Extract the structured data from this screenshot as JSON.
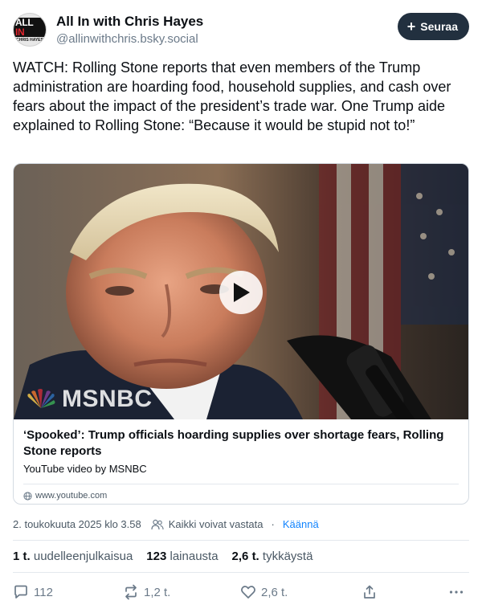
{
  "header": {
    "display_name": "All In with Chris Hayes",
    "handle": "@allinwithchris.bsky.social",
    "avatar_line1_a": "ALL ",
    "avatar_line1_b": "IN",
    "avatar_line2": "CHRIS HAYES",
    "follow_label": "Seuraa"
  },
  "post": {
    "text": "WATCH: Rolling Stone reports that even members of the Trump administration are hoarding food, household supplies, and cash over fears about the impact of the president’s trade war. One Trump aide explained to Rolling Stone: “Because it would be stupid not to!”"
  },
  "embed": {
    "overlay_logo_text": "MSNBC",
    "title": "‘Spooked’: Trump officials hoarding supplies over shortage fears, Rolling Stone reports",
    "description": "YouTube video by MSNBC",
    "domain": "www.youtube.com"
  },
  "meta": {
    "timestamp": "2. toukokuuta 2025 klo 3.58",
    "reply_setting": "Kaikki voivat vastata",
    "separator": "·",
    "translate": "Käännä"
  },
  "stats": {
    "reposts_count": "1 t.",
    "reposts_label": "uudelleenjulkaisua",
    "quotes_count": "123",
    "quotes_label": "lainausta",
    "likes_count": "2,6 t.",
    "likes_label": "tykkäystä"
  },
  "actions": {
    "reply_count": "112",
    "repost_count": "1,2 t.",
    "like_count": "2,6 t."
  },
  "colors": {
    "follow_button": "#22303f",
    "link_blue": "#1083fe",
    "muted": "#6b7a89"
  }
}
